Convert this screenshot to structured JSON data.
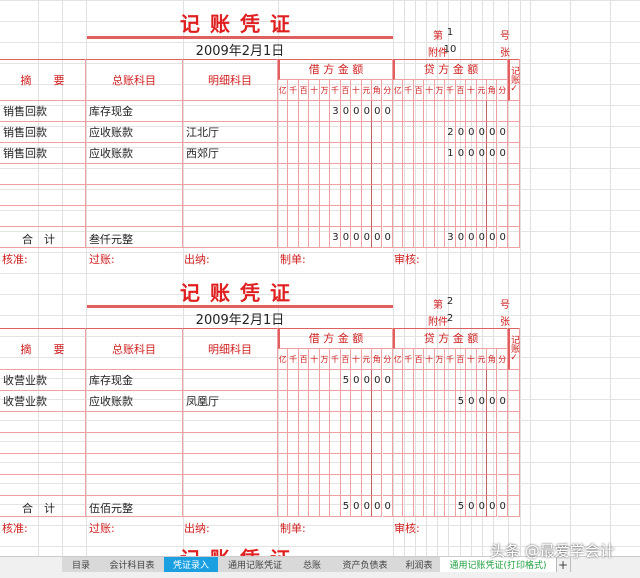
{
  "vouchers": [
    {
      "title": "记账凭证",
      "date": "2009年2月1日",
      "no_label": "第",
      "no": "1",
      "no_unit": "号",
      "att_label": "附件",
      "att": "10",
      "att_unit": "张",
      "rows": [
        {
          "summary": "销售回款",
          "account": "库存现金",
          "detail": "",
          "debit": "300000",
          "credit": ""
        },
        {
          "summary": "销售回款",
          "account": "应收账款",
          "detail": "江北厅",
          "debit": "",
          "credit": "200000"
        },
        {
          "summary": "销售回款",
          "account": "应收账款",
          "detail": "西郊厅",
          "debit": "",
          "credit": "100000"
        },
        {
          "summary": "",
          "account": "",
          "detail": "",
          "debit": "",
          "credit": ""
        },
        {
          "summary": "",
          "account": "",
          "detail": "",
          "debit": "",
          "credit": ""
        },
        {
          "summary": "",
          "account": "",
          "detail": "",
          "debit": "",
          "credit": ""
        }
      ],
      "total_words": "叁仟元整",
      "total_debit": "300000",
      "total_credit": "300000"
    },
    {
      "title": "记账凭证",
      "date": "2009年2月1日",
      "no_label": "第",
      "no": "2",
      "no_unit": "号",
      "att_label": "附件",
      "att": "2",
      "att_unit": "张",
      "rows": [
        {
          "summary": "收营业款",
          "account": "库存现金",
          "detail": "",
          "debit": "50000",
          "credit": ""
        },
        {
          "summary": "收营业款",
          "account": "应收账款",
          "detail": "凤凰厅",
          "debit": "",
          "credit": "50000"
        },
        {
          "summary": "",
          "account": "",
          "detail": "",
          "debit": "",
          "credit": ""
        },
        {
          "summary": "",
          "account": "",
          "detail": "",
          "debit": "",
          "credit": ""
        },
        {
          "summary": "",
          "account": "",
          "detail": "",
          "debit": "",
          "credit": ""
        },
        {
          "summary": "",
          "account": "",
          "detail": "",
          "debit": "",
          "credit": ""
        }
      ],
      "total_words": "伍佰元整",
      "total_debit": "50000",
      "total_credit": "50000"
    }
  ],
  "headers": {
    "summary": "摘　　要",
    "account": "总账科目",
    "detail": "明细科目",
    "debit": "借 方 金 额",
    "credit": "贷 方 金 额",
    "posted": "记账✓",
    "units": [
      "亿",
      "千",
      "百",
      "十",
      "万",
      "千",
      "百",
      "十",
      "元",
      "角",
      "分"
    ],
    "total": "合　计"
  },
  "footer": {
    "approve": "核准:",
    "post": "过账:",
    "cashier": "出纳:",
    "maker": "制单:",
    "review": "审核:"
  },
  "partial_title": "记账凭证",
  "tabs": [
    {
      "label": "目录"
    },
    {
      "label": "会计科目表"
    },
    {
      "label": "凭证录入"
    },
    {
      "label": "通用记账凭证"
    },
    {
      "label": "总账"
    },
    {
      "label": "资产负债表"
    },
    {
      "label": "利润表"
    },
    {
      "label": "通用记账凭证(打印格式)"
    },
    {
      "label": "+"
    }
  ],
  "watermark": "头条 @最爱学会计",
  "colors": {
    "accent": "#e02020",
    "active_tab": "#1aa0e0",
    "active_tab_text": "#20a040"
  }
}
